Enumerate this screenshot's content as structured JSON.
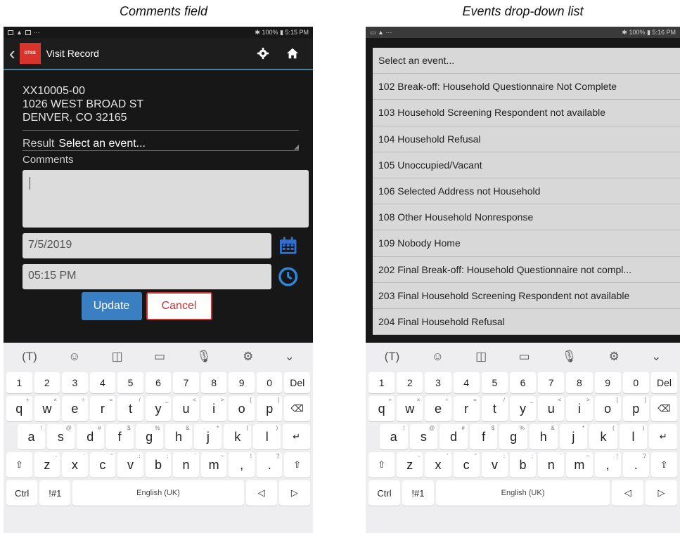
{
  "captions": {
    "left": "Comments field",
    "right": "Events drop-down list"
  },
  "status_bar": {
    "left_time": "5:15 PM",
    "right_time": "5:16 PM",
    "battery": "100%"
  },
  "app_bar": {
    "title": "Visit Record",
    "logo_text": "GTSS"
  },
  "address": {
    "id": "XX10005-00",
    "street": "1026 WEST BROAD ST",
    "city": "DENVER, CO 32165"
  },
  "result": {
    "label": "Result",
    "value": "Select an event..."
  },
  "comments": {
    "label": "Comments",
    "value": ""
  },
  "date_field": {
    "value": "7/5/2019"
  },
  "time_field": {
    "value": "05:15 PM"
  },
  "buttons": {
    "update": "Update",
    "cancel": "Cancel"
  },
  "keyboard": {
    "numbers": [
      "1",
      "2",
      "3",
      "4",
      "5",
      "6",
      "7",
      "8",
      "9",
      "0",
      "Del"
    ],
    "row1": [
      [
        "q",
        "+"
      ],
      [
        "w",
        "×"
      ],
      [
        "e",
        "÷"
      ],
      [
        "r",
        "="
      ],
      [
        "t",
        "/"
      ],
      [
        "y",
        "_"
      ],
      [
        "u",
        "<"
      ],
      [
        "i",
        ">"
      ],
      [
        "o",
        "["
      ],
      [
        "p",
        "]"
      ]
    ],
    "row2": [
      [
        "a",
        "!"
      ],
      [
        "s",
        "@"
      ],
      [
        "d",
        "#"
      ],
      [
        "f",
        "$"
      ],
      [
        "g",
        "%"
      ],
      [
        "h",
        "&"
      ],
      [
        "j",
        "*"
      ],
      [
        "k",
        "("
      ],
      [
        "l",
        ")"
      ]
    ],
    "row3": [
      [
        "z",
        "-"
      ],
      [
        "x",
        "'"
      ],
      [
        "c",
        "\""
      ],
      [
        "v",
        ":"
      ],
      [
        "b",
        ";"
      ],
      [
        "n",
        "`"
      ],
      [
        "m",
        "~"
      ],
      [
        ",",
        "!"
      ],
      [
        ".",
        "?"
      ]
    ],
    "ctrl": "Ctrl",
    "symbols": "!#1",
    "space": "English (UK)"
  },
  "events": [
    "Select an event...",
    "102 Break-off: Household Questionnaire Not Complete",
    "103 Household Screening Respondent not available",
    "104 Household Refusal",
    "105 Unoccupied/Vacant",
    "106 Selected Address not Household",
    "108 Other Household Nonresponse",
    "109 Nobody Home",
    "202 Final Break-off: Household Questionnaire not compl...",
    "203 Final Household Screening Respondent not available",
    "204 Final Household Refusal"
  ],
  "colors": {
    "accent": "#3a7fc1",
    "cancel": "#d03030",
    "logo": "#d9342b",
    "clock": "#2e86de",
    "calendar": "#2e6fd0",
    "hat": "#a040c0"
  }
}
